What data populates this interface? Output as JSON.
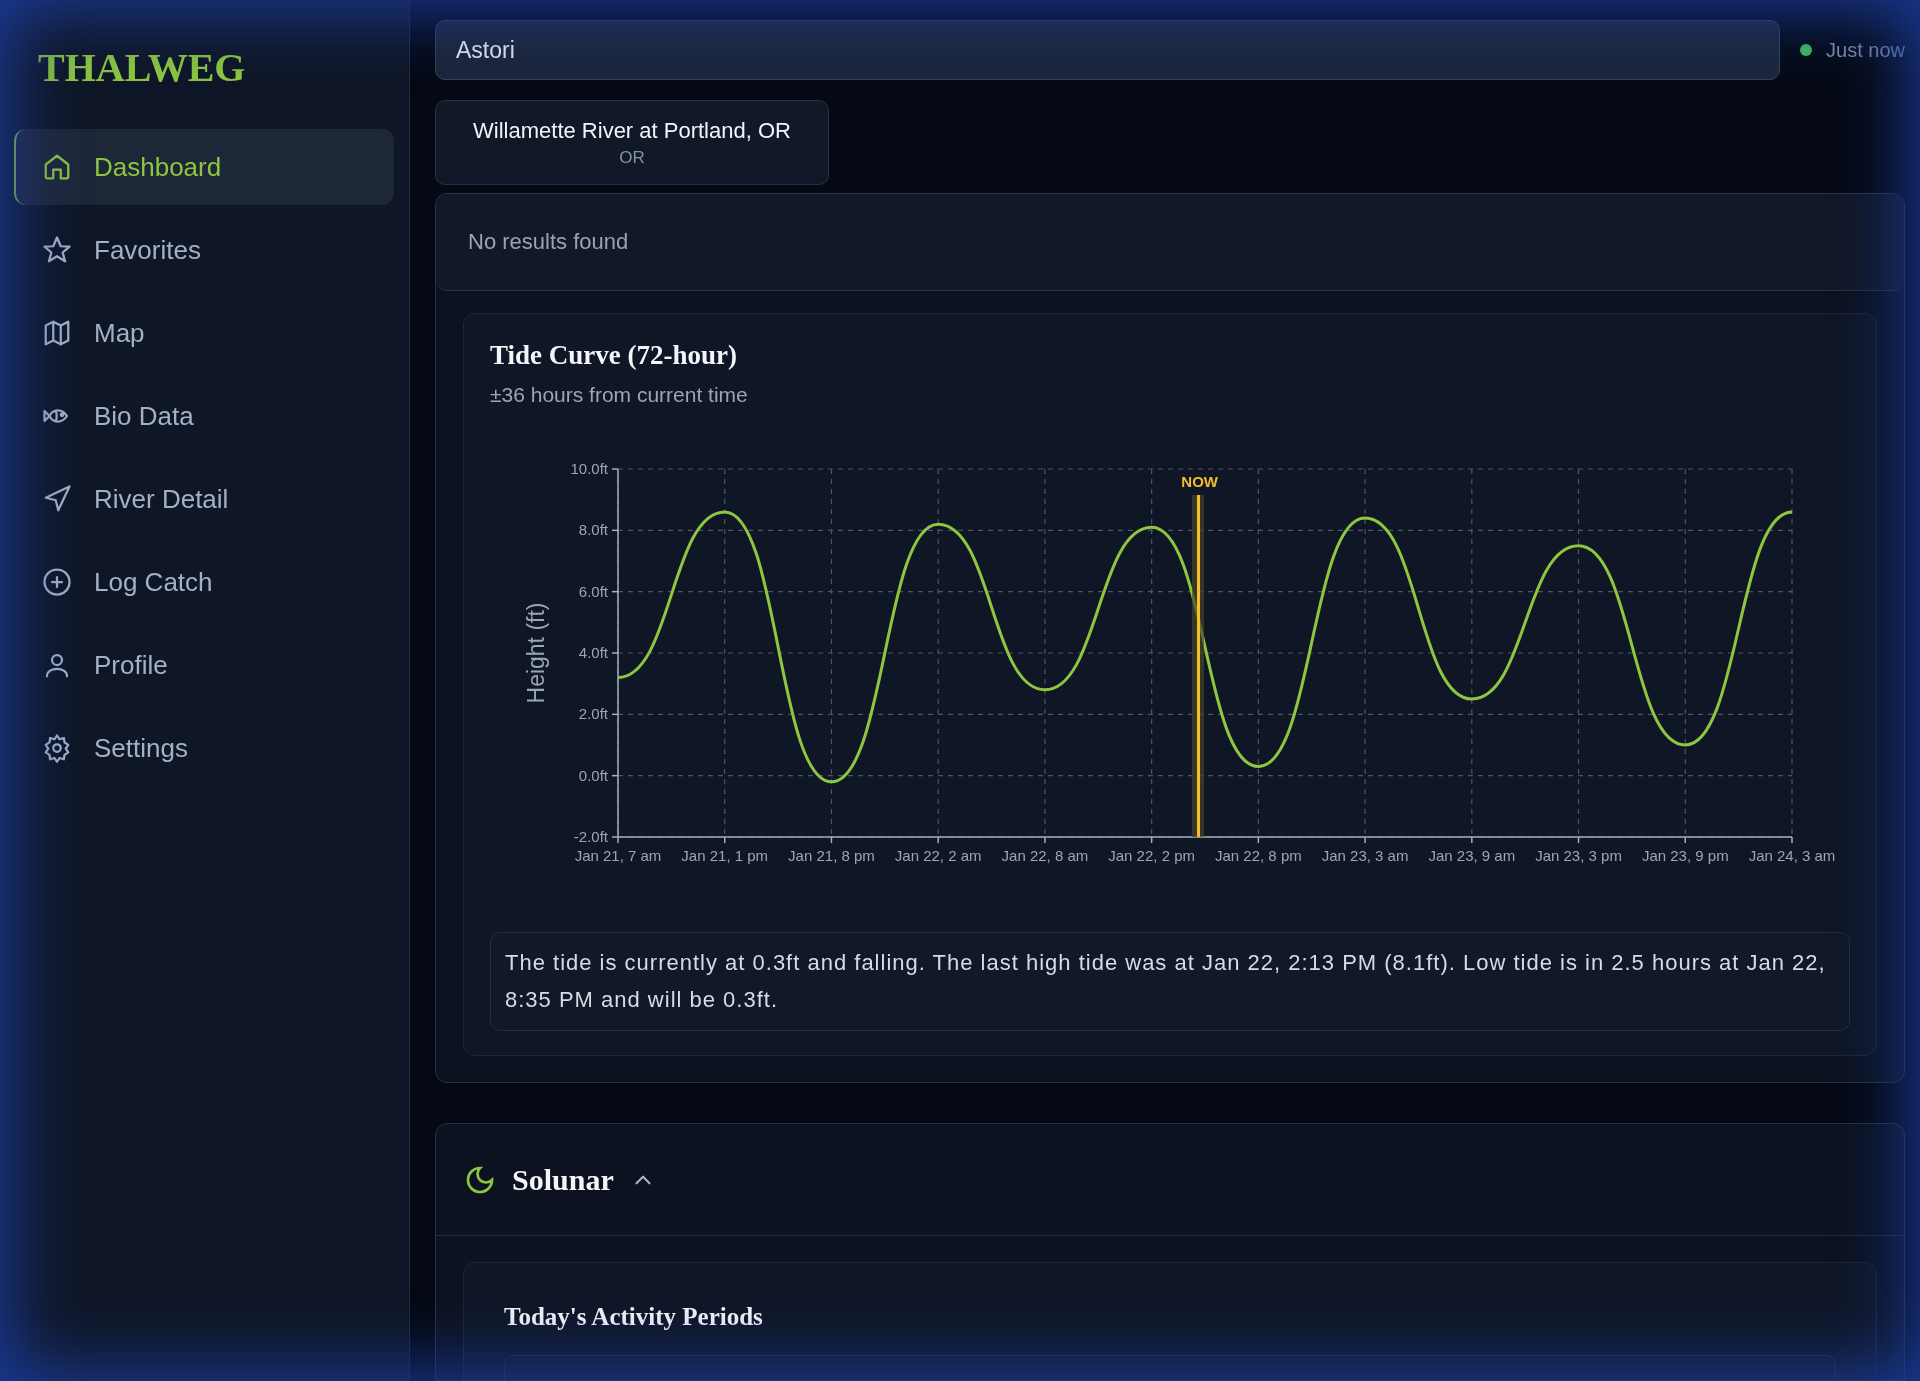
{
  "sidebar": {
    "logo": "THALWEG",
    "items": [
      {
        "label": "Dashboard",
        "selected": true
      },
      {
        "label": "Favorites",
        "selected": false
      },
      {
        "label": "Map",
        "selected": false
      },
      {
        "label": "Bio Data",
        "selected": false
      },
      {
        "label": "River Detail",
        "selected": false
      },
      {
        "label": "Log Catch",
        "selected": false
      },
      {
        "label": "Profile",
        "selected": false
      },
      {
        "label": "Settings",
        "selected": false
      }
    ]
  },
  "search": {
    "value": "Astori"
  },
  "status": {
    "text": "Just now"
  },
  "suggestion": {
    "title": "Willamette River at Portland, OR",
    "subtitle": "OR"
  },
  "no_results": "No results found",
  "tide": {
    "title": "Tide Curve (72-hour)",
    "subtitle": "±36 hours from current time",
    "chart_data": {
      "type": "line",
      "ylabel": "Height (ft)",
      "categories": [
        "Jan 21, 7 am",
        "Jan 21, 1 pm",
        "Jan 21, 8 pm",
        "Jan 22, 2 am",
        "Jan 22, 8 am",
        "Jan 22, 2 pm",
        "Jan 22, 8 pm",
        "Jan 23, 3 am",
        "Jan 23, 9 am",
        "Jan 23, 3 pm",
        "Jan 23, 9 pm",
        "Jan 24, 3 am"
      ],
      "series": [
        {
          "color": "#8dc63f",
          "values": [
            3.2,
            8.6,
            -0.2,
            8.2,
            2.8,
            8.1,
            0.3,
            8.4,
            2.5,
            7.5,
            1.0,
            8.6
          ]
        }
      ],
      "ylim": [
        -2,
        10
      ],
      "yticks": [
        {
          "value": -2,
          "label": "-2.0ft"
        },
        {
          "value": 0,
          "label": "0.0ft"
        },
        {
          "value": 2,
          "label": "2.0ft"
        },
        {
          "value": 4,
          "label": "4.0ft"
        },
        {
          "value": 6,
          "label": "6.0ft"
        },
        {
          "value": 8,
          "label": "8.0ft"
        },
        {
          "value": 10,
          "label": "10.0ft"
        }
      ],
      "grid": true,
      "annotations": [
        "NOW"
      ]
    },
    "summary": "The tide is currently at 0.3ft and falling. The last high tide was at Jan 22, 2:13 PM (8.1ft). Low tide is in 2.5 hours at Jan 22, 8:35 PM and will be 0.3ft."
  },
  "solunar": {
    "title": "Solunar",
    "expanded": true,
    "section_title": "Today's Activity Periods"
  }
}
